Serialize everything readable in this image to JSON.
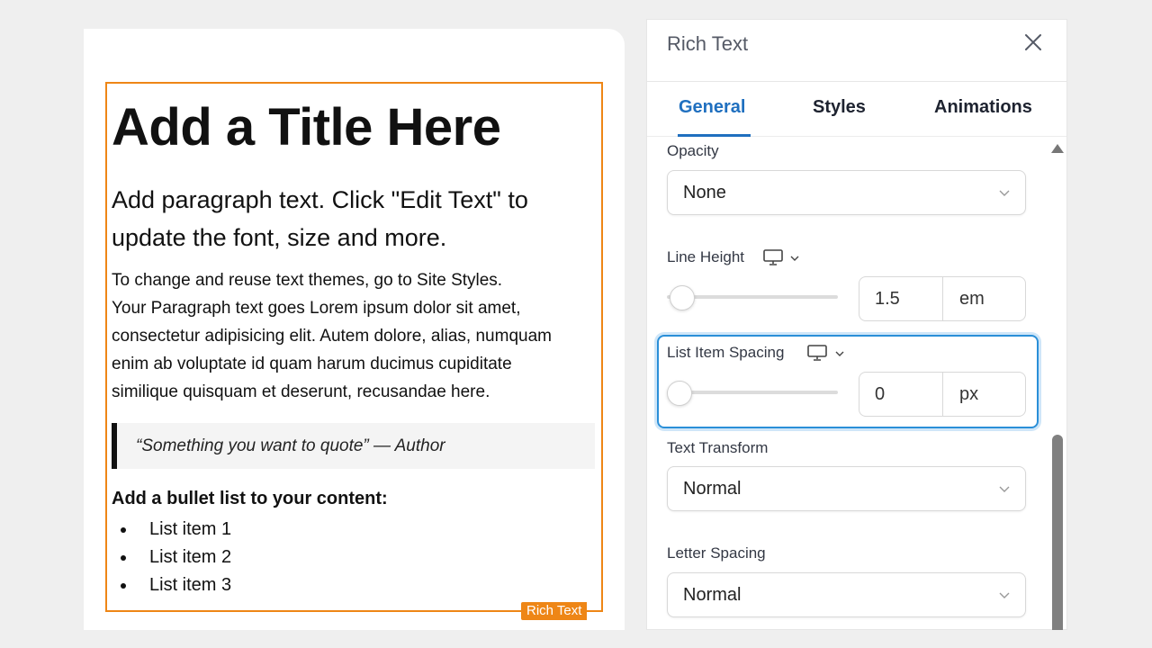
{
  "canvas": {
    "title": "Add a Title Here",
    "lead_line1": "Add paragraph text. Click \"Edit Text\" to",
    "lead_line2": "update the font, size and more.",
    "body_lines": [
      "To change and reuse text themes, go to Site Styles.",
      "Your Paragraph text goes Lorem ipsum dolor sit amet,",
      "consectetur adipisicing elit. Autem dolore, alias, numquam",
      "enim ab voluptate id quam harum ducimus cupiditate",
      "similique quisquam et deserunt, recusandae here."
    ],
    "quote": "“Something you want to quote” — Author",
    "list_heading": "Add a bullet list to your content:",
    "list_items": [
      "List item 1",
      "List item 2",
      "List item 3"
    ],
    "element_tag": "Rich Text",
    "accent_color": "#ee8616"
  },
  "panel": {
    "title": "Rich Text",
    "tabs": [
      {
        "label": "General",
        "active": true
      },
      {
        "label": "Styles",
        "active": false
      },
      {
        "label": "Animations",
        "active": false
      }
    ],
    "active_color": "#1f6fbf",
    "opacity": {
      "label": "Opacity",
      "value": "None"
    },
    "line_height": {
      "label": "Line Height",
      "value": "1.5",
      "unit": "em",
      "slider_fraction": 0.0
    },
    "list_item_spacing": {
      "label": "List Item Spacing",
      "value": "0",
      "unit": "px",
      "slider_fraction": 0.0
    },
    "text_transform": {
      "label": "Text Transform",
      "value": "Normal"
    },
    "letter_spacing": {
      "label": "Letter Spacing",
      "value": "Normal"
    },
    "icons": [
      "close-icon",
      "desktop-icon",
      "chevron-down-icon"
    ]
  }
}
